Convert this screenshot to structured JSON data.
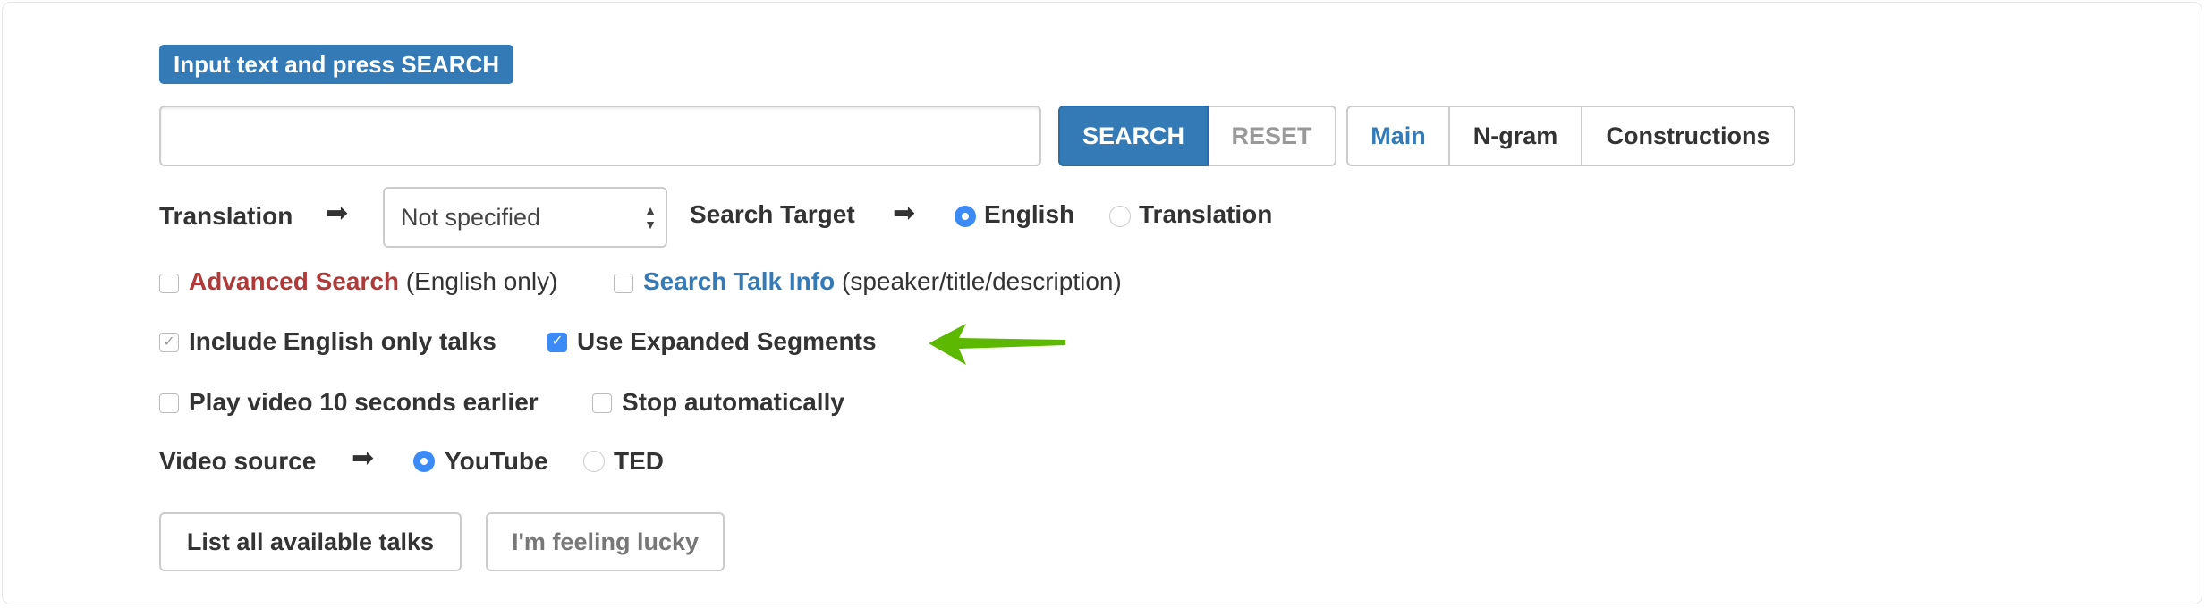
{
  "header": {
    "badge": "Input text and press SEARCH"
  },
  "search": {
    "value": "",
    "placeholder": "",
    "search_label": "SEARCH",
    "reset_label": "RESET"
  },
  "modes": [
    {
      "label": "Main",
      "active": true
    },
    {
      "label": "N-gram"
    },
    {
      "label": "Constructions"
    }
  ],
  "translation": {
    "label": "Translation",
    "selected": "Not specified"
  },
  "target": {
    "label": "Search Target",
    "options": [
      {
        "label": "English",
        "checked": true
      },
      {
        "label": "Translation",
        "checked": false
      }
    ]
  },
  "options": {
    "advanced": {
      "link": "Advanced Search",
      "note": "(English only)",
      "checked": false
    },
    "talkinfo": {
      "link": "Search Talk Info",
      "note": "(speaker/title/description)",
      "checked": false
    },
    "english_only": {
      "label": "Include English only talks",
      "checked": true,
      "disabled": true
    },
    "expanded": {
      "label": "Use Expanded Segments",
      "checked": true
    },
    "earlier": {
      "label": "Play video 10 seconds earlier",
      "checked": false
    },
    "stop": {
      "label": "Stop automatically",
      "checked": false
    }
  },
  "video": {
    "label": "Video source",
    "options": [
      {
        "label": "YouTube",
        "checked": true
      },
      {
        "label": "TED",
        "checked": false
      }
    ]
  },
  "buttons": {
    "list": "List all available talks",
    "lucky": "I'm feeling lucky"
  },
  "colors": {
    "primary": "#337ab7",
    "advanced": "#b03a3a",
    "radio": "#3b8af5",
    "annotation_arrow": "#5cb800"
  }
}
